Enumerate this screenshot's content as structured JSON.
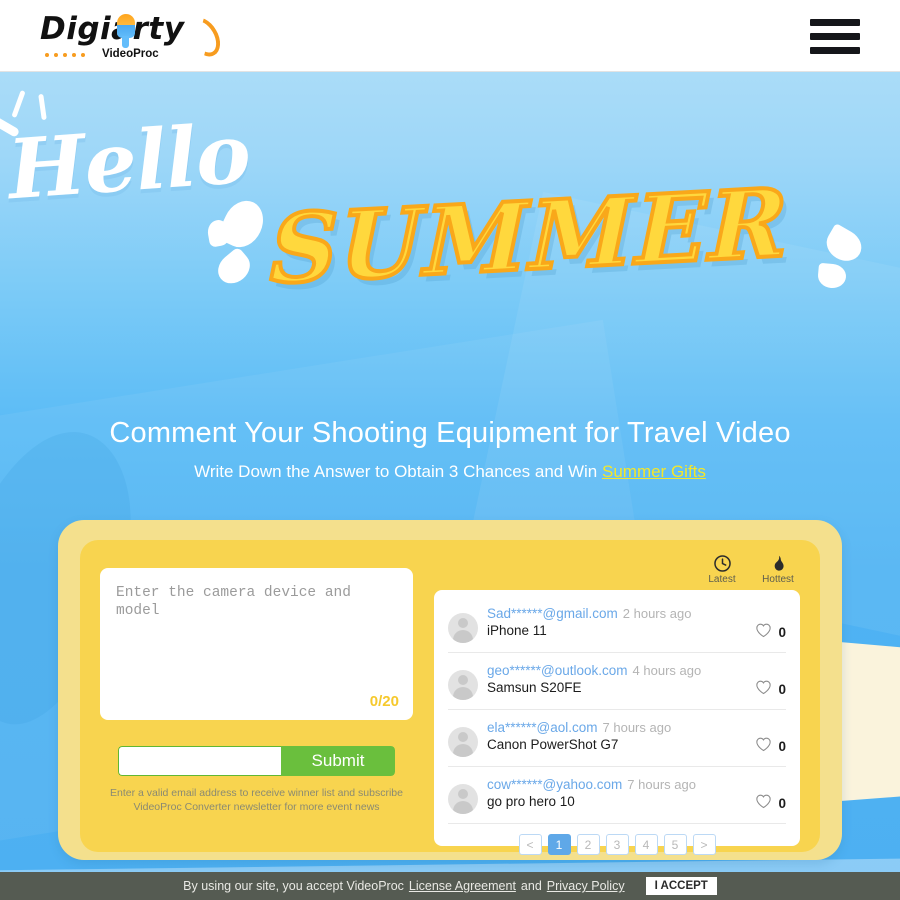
{
  "header": {
    "logo_word": "Digiarty",
    "logo_sub": "VideoProc",
    "menu_icon": "hamburger-menu-icon"
  },
  "hero": {
    "script_text": "Hello",
    "display_text": "SUMMER",
    "headline": "Comment Your Shooting Equipment for Travel Video",
    "subhead_prefix": "Write Down the Answer to Obtain 3 Chances and Win ",
    "subhead_link": "Summer Gifts",
    "colors": {
      "sky": "#4fb6f5",
      "summer_yellow": "#ffd83d",
      "summer_outline": "#f9a81a",
      "link_yellow": "#f4e72a"
    }
  },
  "form": {
    "comment_placeholder": "Enter the camera device and model",
    "char_count": "0/20",
    "email_placeholder": "",
    "email_value": "",
    "submit_label": "Submit",
    "hint_line1": "Enter a valid email address to receive winner list and subscribe",
    "hint_line2": "VideoProc Converter newsletter for more event news",
    "submit_color": "#6abf3d"
  },
  "comments_panel": {
    "sort_tabs": [
      {
        "label": "Latest",
        "icon": "clock-icon",
        "active": true
      },
      {
        "label": "Hottest",
        "icon": "flame-icon",
        "active": false
      }
    ],
    "items": [
      {
        "email": "Sad******@gmail.com",
        "time": "2 hours ago",
        "text": "iPhone 11",
        "likes": "0"
      },
      {
        "email": "geo******@outlook.com",
        "time": "4 hours ago",
        "text": "Samsun S20FE",
        "likes": "0"
      },
      {
        "email": "ela******@aol.com",
        "time": "7 hours ago",
        "text": "Canon PowerShot G7",
        "likes": "0"
      },
      {
        "email": "cow******@yahoo.com",
        "time": "7 hours ago",
        "text": "go pro hero 10",
        "likes": "0"
      }
    ],
    "pagination": {
      "prev": "<",
      "pages": [
        "1",
        "2",
        "3",
        "4",
        "5"
      ],
      "next": ">",
      "active_index": 0,
      "active_color": "#5fa8e8"
    }
  },
  "cookie_bar": {
    "text_prefix": "By using our site, you accept VideoProc",
    "link1": "License Agreement",
    "conjunction": "and",
    "link2": "Privacy Policy",
    "accept_label": "I ACCEPT"
  }
}
